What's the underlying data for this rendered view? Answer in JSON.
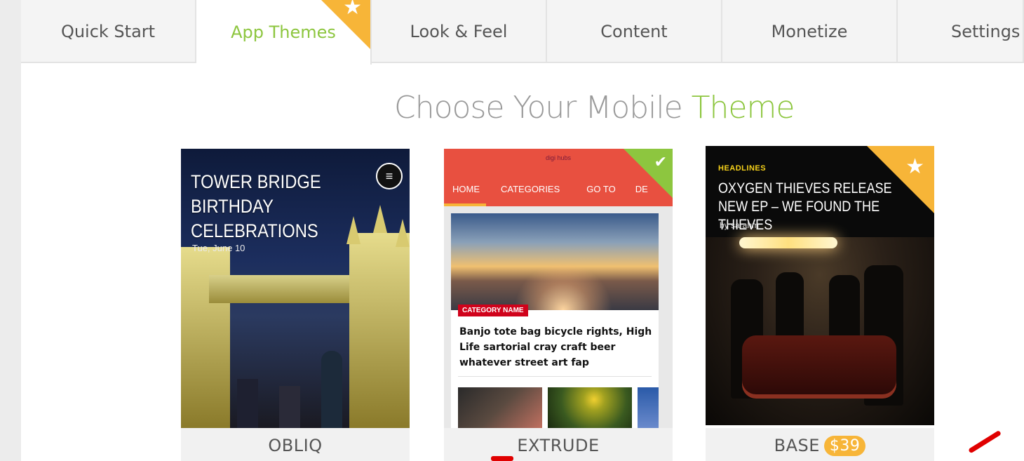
{
  "tabs": [
    {
      "label": "Quick Start",
      "active": false
    },
    {
      "label": "App Themes",
      "active": true
    },
    {
      "label": "Look & Feel",
      "active": false
    },
    {
      "label": "Content",
      "active": false
    },
    {
      "label": "Monetize",
      "active": false
    },
    {
      "label": "Settings",
      "active": false
    }
  ],
  "heading": {
    "main": "Choose Your Mobile ",
    "accent": "Theme"
  },
  "themes": [
    {
      "name": "OBLIQ",
      "preview": {
        "title": "TOWER BRIDGE BIRTHDAY CELEBRATIONS",
        "date": "Tue, June 10"
      }
    },
    {
      "name": "EXTRUDE",
      "preview": {
        "logo": "digi hubs",
        "nav": [
          "HOME",
          "CATEGORIES",
          "GO TO",
          "DE"
        ],
        "category": "CATEGORY NAME",
        "headline": "Banjo tote bag bicycle rights, High Life sartorial cray craft beer whatever street art fap"
      },
      "selected": true
    },
    {
      "name": "BASE",
      "price": "$39",
      "preview": {
        "tag": "HEADLINES",
        "title": "OXYGEN THIEVES RELEASE NEW EP – WE FOUND THE THIEVES",
        "byline": "by sarahm"
      }
    }
  ],
  "colors": {
    "accent_green": "#8dc63f",
    "premium_orange": "#f7b538",
    "extrude_red": "#e85040"
  }
}
